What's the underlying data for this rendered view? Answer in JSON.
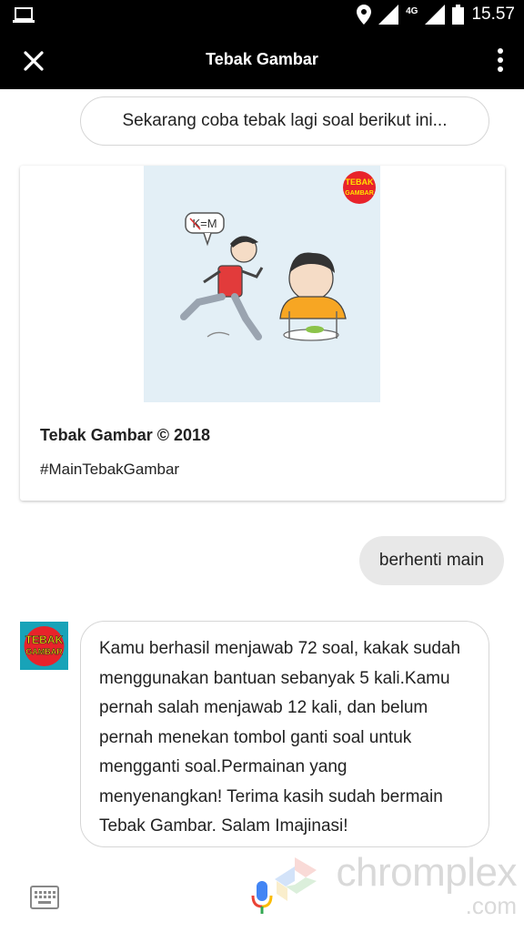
{
  "status": {
    "network": "4G",
    "time": "15.57"
  },
  "appbar": {
    "title": "Tebak Gambar"
  },
  "chat": {
    "suggestion": "Sekarang coba tebak lagi soal berikut ini...",
    "card": {
      "image_label": "K=M",
      "logo_line1": "TEBAK",
      "logo_line2": "GAMBAR",
      "title": "Tebak Gambar © 2018",
      "subtitle": "#MainTebakGambar"
    },
    "user_message": "berhenti main",
    "bot_avatar": {
      "line1": "TEBAK",
      "line2": "GAMBAR"
    },
    "bot_message": "Kamu berhasil menjawab 72 soal, kakak sudah menggunakan bantuan sebanyak 5 kali.Kamu pernah salah menjawab 12 kali, dan belum pernah menekan tombol ganti soal untuk mengganti soal.Permainan yang menyenangkan! Terima kasih sudah bermain Tebak Gambar. Salam Imajinasi!"
  },
  "watermark": {
    "line1": "chromplex",
    "line2": ".com"
  },
  "icons": {
    "laptop": "laptop-icon",
    "location": "location-icon",
    "signal": "signal-icon",
    "battery": "battery-icon",
    "close": "close-icon",
    "more": "more-vert-icon",
    "keyboard": "keyboard-icon",
    "mic": "mic-icon"
  }
}
